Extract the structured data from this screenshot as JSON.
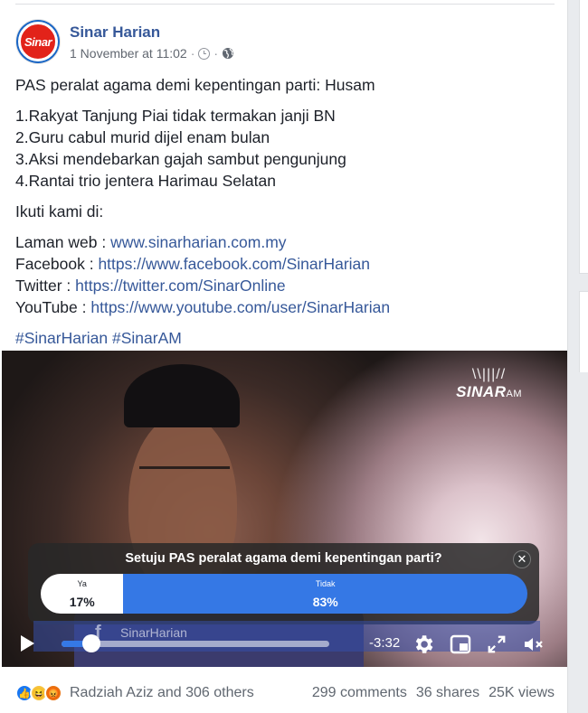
{
  "post": {
    "page_name": "Sinar Harian",
    "avatar_text": "Sinar",
    "timestamp": "1 November at 11:02",
    "separator": "·",
    "headline": "PAS peralat agama demi kepentingan parti: Husam",
    "list_items": [
      "1.Rakyat Tanjung Piai tidak termakan janji BN",
      "2.Guru cabul murid dijel enam bulan",
      "3.Aksi mendebarkan gajah sambut pengunjung",
      "4.Rantai trio jentera Harimau Selatan"
    ],
    "follow_intro": "Ikuti kami di:",
    "links": [
      {
        "label": "Laman web : ",
        "url": "www.sinarharian.com.my"
      },
      {
        "label": "Facebook : ",
        "url": "https://www.facebook.com/SinarHarian"
      },
      {
        "label": "Twitter : ",
        "url": "https://twitter.com/SinarOnline"
      },
      {
        "label": "YouTube : ",
        "url": "https://www.youtube.com/user/SinarHarian"
      }
    ],
    "hashtags": "#SinarHarian #SinarAM"
  },
  "video": {
    "brand_logo": "SINAR",
    "brand_logo_suffix": "AM",
    "brand_rays": "\\\\|||//",
    "watermark_icon": "f",
    "watermark_text": "SinarHarian",
    "time_remaining": "-3:32",
    "progress": 0.11,
    "poll": {
      "question": "Setuju PAS peralat agama demi kepentingan parti?",
      "close_glyph": "✕",
      "options": [
        {
          "label": "Ya",
          "percent": "17%",
          "value": 17
        },
        {
          "label": "Tidak",
          "percent": "83%",
          "value": 83
        }
      ]
    }
  },
  "footer": {
    "reactions": [
      "like-icon",
      "haha-icon",
      "angry-icon"
    ],
    "reactors": "Radziah Aziz and 306 others",
    "comments": "299 comments",
    "shares": "36 shares",
    "views": "25K views"
  },
  "colors": {
    "link": "#365899",
    "accent": "#3578e5",
    "text": "#1d2129",
    "muted": "#606770"
  }
}
